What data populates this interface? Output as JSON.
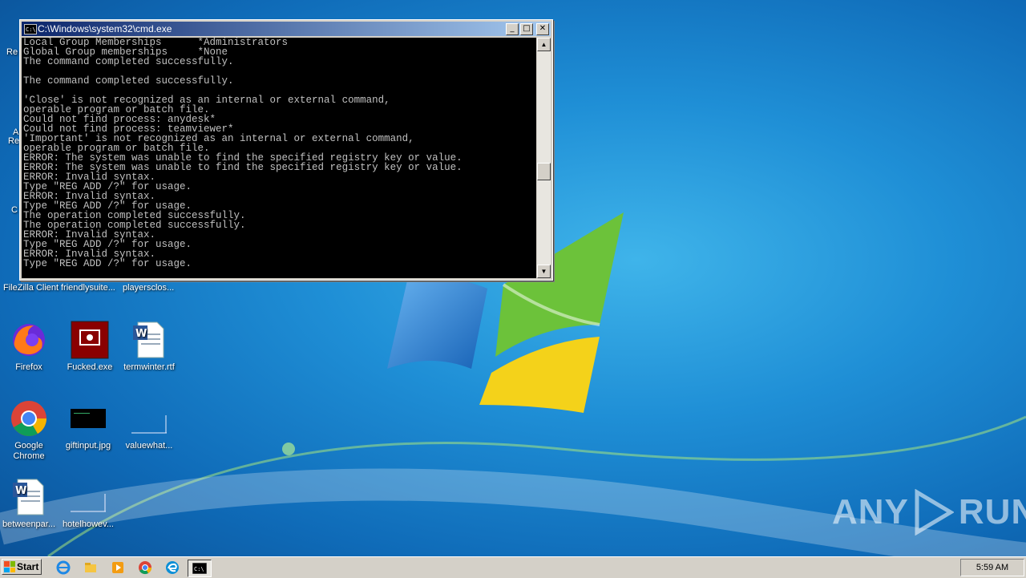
{
  "window": {
    "title": "C:\\Windows\\system32\\cmd.exe",
    "minimize": "_",
    "maximize": "□",
    "close": "✕"
  },
  "console_lines": [
    "Local Group Memberships      *Administrators",
    "Global Group memberships     *None",
    "The command completed successfully.",
    "",
    "The command completed successfully.",
    "",
    "'Close' is not recognized as an internal or external command,",
    "operable program or batch file.",
    "Could not find process: anydesk*",
    "Could not find process: teamviewer*",
    "'Important' is not recognized as an internal or external command,",
    "operable program or batch file.",
    "ERROR: The system was unable to find the specified registry key or value.",
    "ERROR: The system was unable to find the specified registry key or value.",
    "ERROR: Invalid syntax.",
    "Type \"REG ADD /?\" for usage.",
    "ERROR: Invalid syntax.",
    "Type \"REG ADD /?\" for usage.",
    "The operation completed successfully.",
    "The operation completed successfully.",
    "ERROR: Invalid syntax.",
    "Type \"REG ADD /?\" for usage.",
    "ERROR: Invalid syntax.",
    "Type \"REG ADD /?\" for usage."
  ],
  "desktop": {
    "partial_labels": [
      "Re",
      "A",
      "Re",
      "C"
    ],
    "row1": [
      "FileZilla Client",
      "friendlysuite...",
      "playersclos..."
    ],
    "icons": [
      {
        "label": "Firefox",
        "icon": "firefox-icon"
      },
      {
        "label": "Fucked.exe",
        "icon": "red-app-icon"
      },
      {
        "label": "termwinter.rtf",
        "icon": "word-document-icon"
      },
      {
        "label": "Google Chrome",
        "icon": "chrome-icon"
      },
      {
        "label": "giftinput.jpg",
        "icon": "image-thumbnail-icon"
      },
      {
        "label": "valuewhat...",
        "icon": "blank-file-icon"
      },
      {
        "label": "betweenpar...",
        "icon": "word-document-icon"
      },
      {
        "label": "hotelhowev...",
        "icon": "blank-file-icon"
      }
    ]
  },
  "watermark": {
    "left": "ANY",
    "right": "RUN"
  },
  "taskbar": {
    "start_label": "Start",
    "clock": "5:59 AM",
    "apps": [
      "ie-icon",
      "explorer-icon",
      "media-player-icon",
      "chrome-icon",
      "edge-icon",
      "cmd-icon"
    ]
  },
  "colors": {
    "desktop_blue": "#1f8fd6",
    "title_bar": "#0a246a",
    "console_text": "#c0c0c0"
  }
}
